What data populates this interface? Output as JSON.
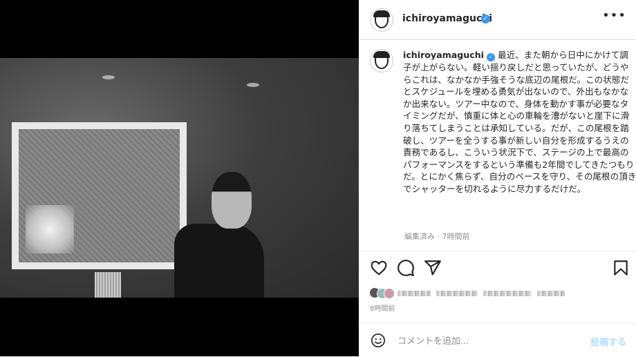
{
  "header": {
    "username": "ichiroyamaguchi",
    "verified_icon": "verified-badge-icon",
    "more_icon": "more-options-icon"
  },
  "caption": {
    "username": "ichiroyamaguchi",
    "text": "最近、また朝から日中にかけて調子が上がらない。軽い揺り戻しだと思っていたが、どうやらこれは、なかなか手強そうな底辺の尾根だ。この状態だとスケジュールを埋める勇気が出ないので、外出もなかなか出来ない。ツアー中なので、身体を動かす事が必要なタイミングだが、慎重に体と心の車輪を漕がないと崖下に滑り落ちてしまうことは承知している。だが、この尾根を踏破し、ツアーを全うする事が新しい自分を形成するうえの責務であるし、こういう状況下で、ステージの上で最高のパフォーマンスをするという準備も2年間でしてきたつもりだ。とにかく焦らず、自分のペースを守り、その尾根の頂きでシャッターを切れるように尽力するだけだ。",
    "meta": "編集済み · 7時間前"
  },
  "actions": {
    "like_icon": "heart-icon",
    "comment_icon": "comment-icon",
    "share_icon": "share-icon",
    "save_icon": "bookmark-icon"
  },
  "post_time": "8時間前",
  "comment_box": {
    "placeholder": "コメントを追加...",
    "post_label": "投稿する",
    "emoji_icon": "emoji-icon"
  },
  "colors": {
    "verified": "#3897f0",
    "post_button_disabled": "#b2dffc",
    "muted_text": "#8e8e8e"
  }
}
